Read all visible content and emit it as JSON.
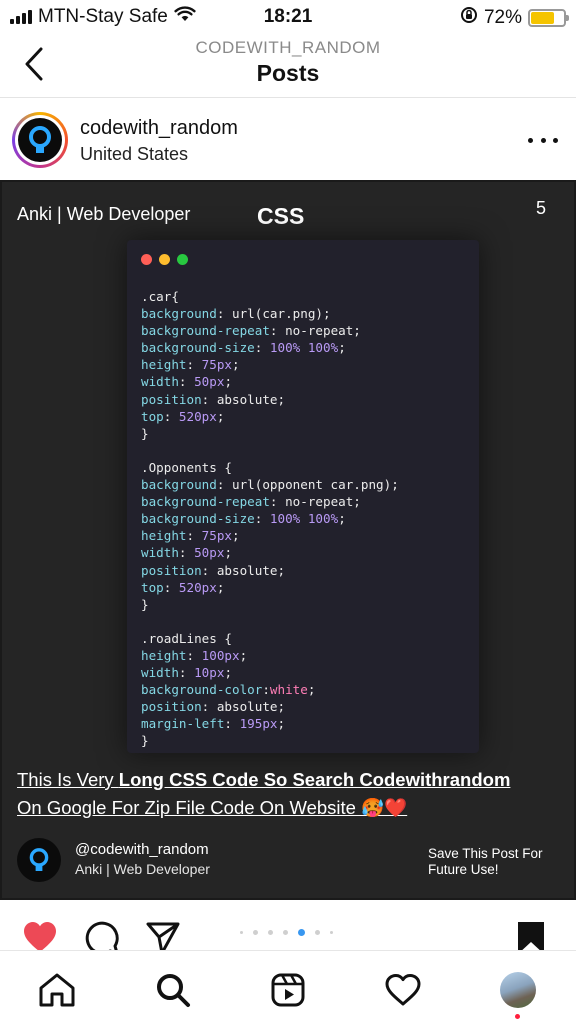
{
  "status_bar": {
    "carrier": "MTN-Stay Safe",
    "time": "18:21",
    "battery": "72%",
    "battery_level": 0.72,
    "icons": [
      "signal-icon",
      "wifi-icon",
      "rotation-lock-icon",
      "battery-icon"
    ]
  },
  "header": {
    "subtitle": "CODEWITH_RANDOM",
    "title": "Posts",
    "back_icon": "chevron-left-icon"
  },
  "post": {
    "username": "codewith_random",
    "location": "United States",
    "more_icon": "ellipsis-icon"
  },
  "image": {
    "author": "Anki | Web Developer",
    "topic": "CSS",
    "slide_number": "5",
    "code_lines": [
      ".car{",
      "background: url(car.png);",
      "background-repeat: no-repeat;",
      "background-size: 100% 100%;",
      "height: 75px;",
      "width: 50px;",
      "position: absolute;",
      "top: 520px;",
      "}",
      "",
      ".Opponents {",
      "background: url(opponent car.png);",
      "background-repeat: no-repeat;",
      "background-size: 100% 100%;",
      "height: 75px;",
      "width: 50px;",
      "position: absolute;",
      "top: 520px;",
      "}",
      "",
      ".roadLines {",
      "height: 100px;",
      "width: 10px;",
      "background-color: white;",
      "position: absolute;",
      "margin-left: 195px;",
      "}"
    ],
    "caption_part1": "This Is Very ",
    "caption_part2": "Long CSS Code So Search Codewithrandom",
    "caption_part3": "On Google For Zip File Code On Website 🥵❤️",
    "footer_handle": "@codewith_random",
    "footer_subtitle": "Anki | Web Developer",
    "footer_save": "Save This Post For Future Use!"
  },
  "actions": {
    "icons": [
      "heart-filled-icon",
      "comment-icon",
      "share-icon",
      "bookmark-icon"
    ],
    "like_color": "#ed4956",
    "carousel_count": 7,
    "carousel_active_index": 4
  },
  "tab_bar": {
    "icons": [
      "home-icon",
      "search-icon",
      "reels-icon",
      "heart-icon",
      "profile-avatar"
    ],
    "notification_color": "#ff1f3d"
  },
  "colors": {
    "post_background": "#252525",
    "code_background": "#22212c",
    "window_dots": [
      "#ff5f57",
      "#febc2e",
      "#28c840"
    ]
  }
}
